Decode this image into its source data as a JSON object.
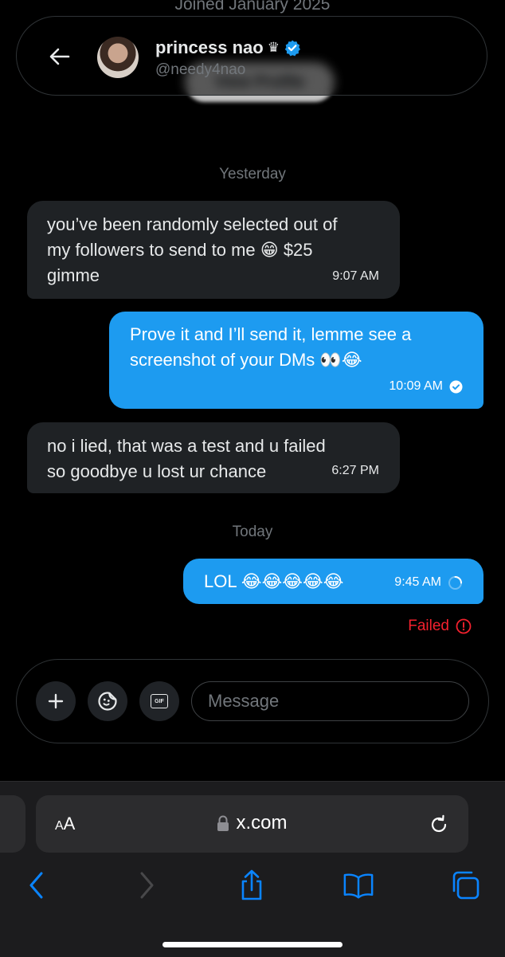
{
  "profile": {
    "joined_text": "Joined January 2025",
    "view_profile_label": "View Profile"
  },
  "header": {
    "name": "princess nao",
    "crown_glyph": "♛",
    "handle": "@needy4nao",
    "verified_color": "#1d9bf0"
  },
  "conversation": {
    "day_labels": [
      "Yesterday",
      "Today"
    ],
    "messages": [
      {
        "direction": "incoming",
        "lines": [
          "you’ve been randomly selected out of",
          "my followers to send to me 😁 $25",
          "gimme"
        ],
        "time": "9:07 AM"
      },
      {
        "direction": "outgoing",
        "lines": [
          "Prove it and I’ll send it, lemme see a",
          "screenshot of your DMs 👀😂"
        ],
        "time": "10:09 AM",
        "status": "sent"
      },
      {
        "direction": "incoming",
        "lines": [
          "no i lied, that was a test and u failed",
          "so goodbye u lost ur chance"
        ],
        "time": "6:27 PM"
      },
      {
        "direction": "outgoing",
        "lines": [
          "LOL 😂😂😂😂😂"
        ],
        "time": "9:45 AM",
        "status": "sending"
      }
    ],
    "failed_label": "Failed"
  },
  "composer": {
    "gif_label": "GIF",
    "placeholder": "Message"
  },
  "browser": {
    "aa_small": "A",
    "aa_large": "A",
    "domain": "x.com",
    "accent_color": "#0a84ff"
  },
  "colors": {
    "background": "#000000",
    "incoming_bubble": "#1f2225",
    "outgoing_bubble": "#1d9bf0",
    "failed": "#f4212e"
  }
}
